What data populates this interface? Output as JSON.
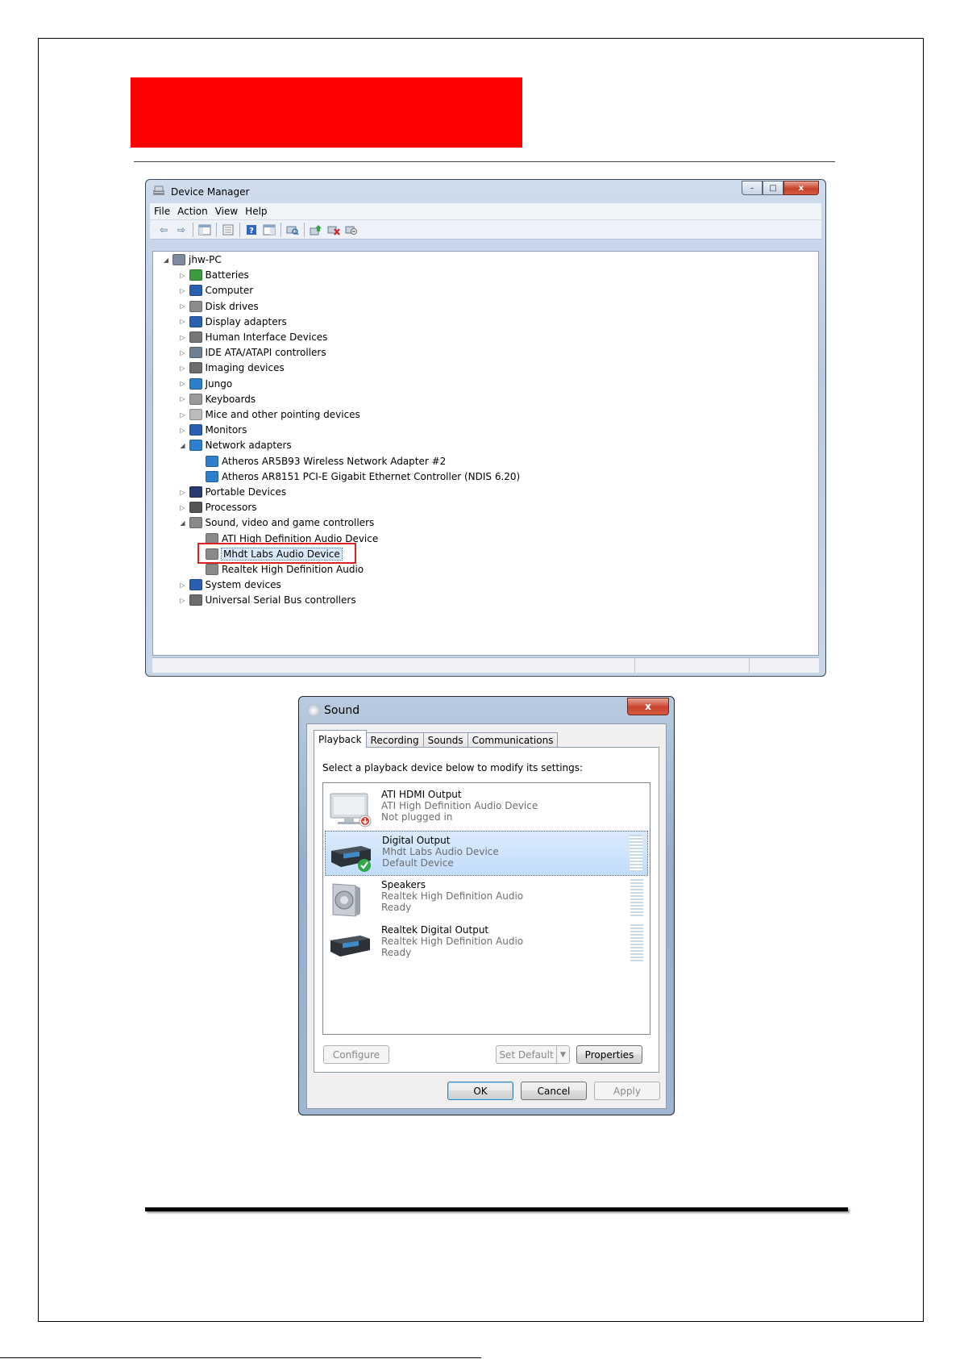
{
  "device_manager": {
    "title": "Device Manager",
    "menu": [
      "File",
      "Action",
      "View",
      "Help"
    ],
    "toolbar_icons": [
      "back-arrow-icon",
      "forward-arrow-icon",
      "show-hide-console-tree-icon",
      "properties-icon",
      "help-icon",
      "action-pane-icon",
      "scan-hardware-icon",
      "update-driver-icon",
      "uninstall-icon",
      "disable-icon"
    ],
    "window_buttons": {
      "minimize": "–",
      "maximize": "□",
      "close": "x"
    },
    "tree": [
      {
        "label": "jhw-PC",
        "indent": 0,
        "expander": "expanded",
        "icon": "computer-icon",
        "color": "#7e8aa0"
      },
      {
        "label": "Batteries",
        "indent": 1,
        "expander": "collapsed",
        "icon": "battery-icon",
        "color": "#3e9a3e"
      },
      {
        "label": "Computer",
        "indent": 1,
        "expander": "collapsed",
        "icon": "monitor-icon",
        "color": "#2b5fb0"
      },
      {
        "label": "Disk drives",
        "indent": 1,
        "expander": "collapsed",
        "icon": "disk-drive-icon",
        "color": "#8c8c8c"
      },
      {
        "label": "Display adapters",
        "indent": 1,
        "expander": "collapsed",
        "icon": "display-adapter-icon",
        "color": "#2b5fb0"
      },
      {
        "label": "Human Interface Devices",
        "indent": 1,
        "expander": "collapsed",
        "icon": "hid-icon",
        "color": "#777777"
      },
      {
        "label": "IDE ATA/ATAPI controllers",
        "indent": 1,
        "expander": "collapsed",
        "icon": "ide-controller-icon",
        "color": "#6d7f91"
      },
      {
        "label": "Imaging devices",
        "indent": 1,
        "expander": "collapsed",
        "icon": "imaging-device-icon",
        "color": "#6d6d6d"
      },
      {
        "label": "Jungo",
        "indent": 1,
        "expander": "collapsed",
        "icon": "jungo-icon",
        "color": "#2d7fcc"
      },
      {
        "label": "Keyboards",
        "indent": 1,
        "expander": "collapsed",
        "icon": "keyboard-icon",
        "color": "#9a9a9a"
      },
      {
        "label": "Mice and other pointing devices",
        "indent": 1,
        "expander": "collapsed",
        "icon": "mouse-icon",
        "color": "#bbbbbb"
      },
      {
        "label": "Monitors",
        "indent": 1,
        "expander": "collapsed",
        "icon": "monitor-icon",
        "color": "#2b5fb0"
      },
      {
        "label": "Network adapters",
        "indent": 1,
        "expander": "expanded",
        "icon": "network-adapter-icon",
        "color": "#2d7fcc"
      },
      {
        "label": "Atheros AR5B93 Wireless Network Adapter #2",
        "indent": 2,
        "expander": "none",
        "icon": "network-adapter-icon",
        "color": "#2d7fcc"
      },
      {
        "label": "Atheros AR8151 PCI-E Gigabit Ethernet Controller (NDIS 6.20)",
        "indent": 2,
        "expander": "none",
        "icon": "network-adapter-icon",
        "color": "#2d7fcc"
      },
      {
        "label": "Portable Devices",
        "indent": 1,
        "expander": "collapsed",
        "icon": "portable-device-icon",
        "color": "#2b3a6e"
      },
      {
        "label": "Processors",
        "indent": 1,
        "expander": "collapsed",
        "icon": "processor-icon",
        "color": "#555555"
      },
      {
        "label": "Sound, video and game controllers",
        "indent": 1,
        "expander": "expanded",
        "icon": "speaker-icon",
        "color": "#8a8a8a"
      },
      {
        "label": "ATI High Definition Audio Device",
        "indent": 2,
        "expander": "none",
        "icon": "speaker-icon",
        "color": "#8a8a8a"
      },
      {
        "label": "Mhdt Labs Audio Device",
        "indent": 2,
        "expander": "none",
        "icon": "speaker-icon",
        "color": "#8a8a8a",
        "selected": true
      },
      {
        "label": "Realtek High Definition Audio",
        "indent": 2,
        "expander": "none",
        "icon": "speaker-icon",
        "color": "#8a8a8a"
      },
      {
        "label": "System devices",
        "indent": 1,
        "expander": "collapsed",
        "icon": "system-device-icon",
        "color": "#2b5fb0"
      },
      {
        "label": "Universal Serial Bus controllers",
        "indent": 1,
        "expander": "collapsed",
        "icon": "usb-icon",
        "color": "#6d6d6d"
      }
    ]
  },
  "sound_dialog": {
    "title": "Sound",
    "close_label": "x",
    "tabs": [
      "Playback",
      "Recording",
      "Sounds",
      "Communications"
    ],
    "active_tab": "Playback",
    "instruction": "Select a playback device below to modify its settings:",
    "devices": [
      {
        "name": "ATI HDMI Output",
        "sub": "ATI High Definition Audio Device",
        "status": "Not plugged in",
        "icon": "hdmi-monitor-icon",
        "badge": "unplugged-icon",
        "level_meter": false,
        "selected": false
      },
      {
        "name": "Digital Output",
        "sub": "Mhdt Labs Audio Device",
        "status": "Default Device",
        "icon": "digital-output-device-icon",
        "badge": "default-check-icon",
        "level_meter": true,
        "selected": true
      },
      {
        "name": "Speakers",
        "sub": "Realtek High Definition Audio",
        "status": "Ready",
        "icon": "speaker-device-icon",
        "badge": "",
        "level_meter": true,
        "selected": false
      },
      {
        "name": "Realtek Digital Output",
        "sub": "Realtek High Definition Audio",
        "status": "Ready",
        "icon": "digital-output-device-icon",
        "badge": "",
        "level_meter": true,
        "selected": false
      }
    ],
    "buttons": {
      "configure": "Configure",
      "set_default": "Set Default",
      "set_default_arrow": "▼",
      "properties": "Properties",
      "ok": "OK",
      "cancel": "Cancel",
      "apply": "Apply"
    }
  },
  "colors": {
    "banner": "#ff0000",
    "highlight_box": "#e02020"
  }
}
